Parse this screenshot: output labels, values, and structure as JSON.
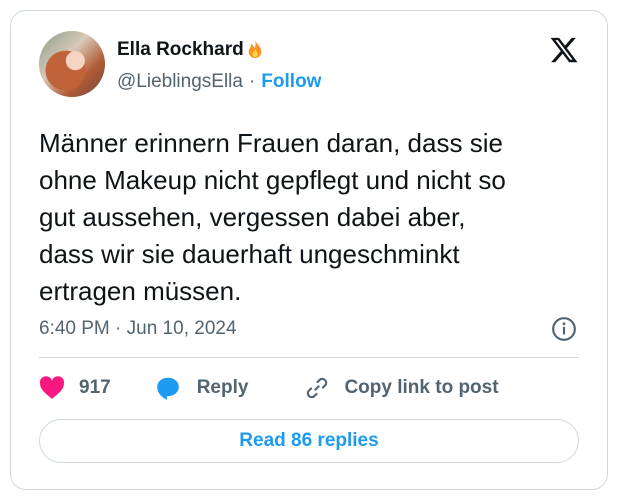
{
  "author": {
    "name": "Ella Rockhard",
    "emoji": "fire",
    "handle": "@LieblingsElla",
    "separator": "·",
    "follow_label": "Follow"
  },
  "tweet": {
    "text": "Männer erinnern Frauen daran, dass sie\nohne Makeup nicht gepflegt und nicht so\ngut aussehen, vergessen dabei aber,\ndass wir sie dauerhaft ungeschminkt\nertragen müssen.",
    "timestamp": "6:40 PM · Jun 10, 2024"
  },
  "actions": {
    "like_count": "917",
    "reply_label": "Reply",
    "copy_label": "Copy link to post"
  },
  "read_replies_label": "Read 86 replies",
  "colors": {
    "accent": "#1d9bf0",
    "like": "#f91880",
    "text": "#0f1419",
    "muted": "#536471",
    "border": "#cfd9de"
  },
  "icons": [
    "x-logo-icon",
    "fire-icon",
    "info-icon",
    "heart-icon",
    "reply-bubble-icon",
    "link-icon"
  ]
}
